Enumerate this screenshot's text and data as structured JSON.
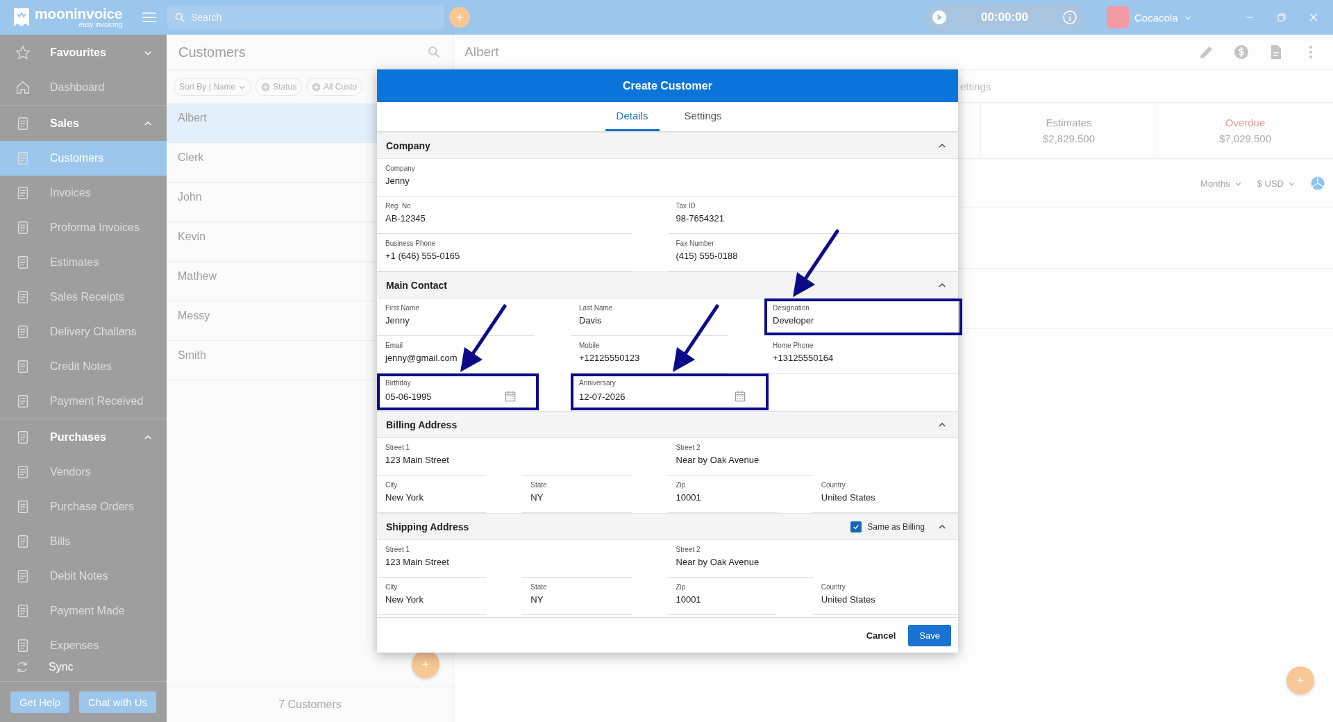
{
  "topbar": {
    "app_name": "mooninvoice",
    "tagline": "easy invoicing",
    "search": {
      "placeholder": "Search"
    },
    "timer": "00:00:00",
    "company": "Cocacola"
  },
  "sidebar": {
    "items": [
      {
        "kind": "group",
        "label": "Favourites",
        "expanded": false
      },
      {
        "kind": "item",
        "label": "Dashboard",
        "selected": false
      },
      {
        "kind": "group",
        "label": "Sales",
        "expanded": true,
        "children": [
          {
            "label": "Customers",
            "selected": true
          },
          {
            "label": "Invoices",
            "selected": false
          },
          {
            "label": "Proforma Invoices",
            "selected": false
          },
          {
            "label": "Estimates",
            "selected": false
          },
          {
            "label": "Sales Receipts",
            "selected": false
          },
          {
            "label": "Delivery Challans",
            "selected": false
          },
          {
            "label": "Credit Notes",
            "selected": false
          },
          {
            "label": "Payment Received",
            "selected": false
          }
        ]
      },
      {
        "kind": "group",
        "label": "Purchases",
        "expanded": true,
        "children": [
          {
            "label": "Vendors",
            "selected": false
          },
          {
            "label": "Purchase Orders",
            "selected": false
          },
          {
            "label": "Bills",
            "selected": false
          },
          {
            "label": "Debit Notes",
            "selected": false
          },
          {
            "label": "Payment Made",
            "selected": false
          },
          {
            "label": "Expenses",
            "selected": false
          }
        ]
      }
    ],
    "sync": "Sync",
    "buttons": [
      "Get Help",
      "Chat with Us"
    ]
  },
  "customers": {
    "title": "Customers",
    "filters": [
      "Sort By | Name",
      "Status",
      "All Custo"
    ],
    "rows": [
      {
        "name": "Albert",
        "selected": true
      },
      {
        "name": "Clerk",
        "selected": false
      },
      {
        "name": "John",
        "selected": false
      },
      {
        "name": "Kevin",
        "selected": false
      },
      {
        "name": "Mathew",
        "selected": false
      },
      {
        "name": "Messy",
        "selected": false
      },
      {
        "name": "Smith",
        "selected": false
      }
    ],
    "count": "7 Customers"
  },
  "detail": {
    "title": "Albert",
    "tab_fragment": "ettings",
    "stats": [
      {
        "label": "Estimates",
        "value": "$2,829.500",
        "kind": "normal"
      },
      {
        "label": "Overdue",
        "value": "$7,029.500",
        "kind": "alert"
      }
    ],
    "period": "Months",
    "currency": "$ USD"
  },
  "dialog": {
    "title": "Create Customer",
    "tabs": [
      {
        "label": "Details",
        "selected": true
      },
      {
        "label": "Settings",
        "selected": false
      }
    ],
    "sections": [
      {
        "title": "Company",
        "expanded": true,
        "rows": [
          [
            {
              "label": "Company",
              "value": "Jenny",
              "kind": "text",
              "highlighted": false
            }
          ],
          [
            {
              "label": "Reg. No",
              "value": "AB-12345",
              "kind": "text",
              "highlighted": false
            },
            {
              "label": "Tax ID",
              "value": "98-7654321",
              "kind": "text",
              "highlighted": false
            }
          ],
          [
            {
              "label": "Business Phone",
              "value": "+1 (646) 555-0165",
              "kind": "text",
              "highlighted": false
            },
            {
              "label": "Fax Number",
              "value": "(415) 555-0188",
              "kind": "text",
              "highlighted": false
            }
          ]
        ]
      },
      {
        "title": "Main Contact",
        "expanded": true,
        "rows": [
          [
            {
              "label": "First Name",
              "value": "Jenny",
              "kind": "text",
              "highlighted": false
            },
            {
              "label": "Last Name",
              "value": "Davis",
              "kind": "text",
              "highlighted": false
            },
            {
              "label": "Designation",
              "value": "Developer",
              "kind": "text",
              "highlighted": true
            }
          ],
          [
            {
              "label": "Email",
              "value": "jenny@gmail.com",
              "kind": "text",
              "highlighted": false
            },
            {
              "label": "Mobile",
              "value": "+12125550123",
              "kind": "text",
              "highlighted": false
            },
            {
              "label": "Home Phone",
              "value": "+13125550164",
              "kind": "text",
              "highlighted": false
            }
          ],
          [
            {
              "label": "Birthday",
              "value": "05-06-1995",
              "kind": "date",
              "highlighted": true
            },
            {
              "label": "Anniversary",
              "value": "12-07-2026",
              "kind": "date",
              "highlighted": true
            }
          ]
        ]
      },
      {
        "title": "Billing Address",
        "expanded": true,
        "rows": [
          [
            {
              "label": "Street 1",
              "value": "123 Main Street",
              "kind": "text",
              "highlighted": false
            },
            "",
            {
              "label": "Street 2",
              "value": "Near by Oak Avenue",
              "kind": "text",
              "highlighted": false
            }
          ],
          [
            {
              "label": "City",
              "value": "New York",
              "kind": "text",
              "highlighted": false
            },
            {
              "label": "State",
              "value": "NY",
              "kind": "text",
              "highlighted": false
            },
            {
              "label": "Zip",
              "value": "10001",
              "kind": "text",
              "highlighted": false
            },
            {
              "label": "Country",
              "value": "United States",
              "kind": "text",
              "highlighted": false
            }
          ]
        ]
      },
      {
        "title": "Shipping Address",
        "expanded": true,
        "same_as_billing": {
          "label": "Same as Billing",
          "checked": true
        },
        "rows": [
          [
            {
              "label": "Street 1",
              "value": "123 Main Street",
              "kind": "text",
              "highlighted": false
            },
            "",
            {
              "label": "Street 2",
              "value": "Near by Oak Avenue",
              "kind": "text",
              "highlighted": false
            }
          ],
          [
            {
              "label": "City",
              "value": "New York",
              "kind": "text",
              "highlighted": false
            },
            {
              "label": "State",
              "value": "NY",
              "kind": "text",
              "highlighted": false
            },
            {
              "label": "Zip",
              "value": "10001",
              "kind": "text",
              "highlighted": false
            },
            {
              "label": "Country",
              "value": "United States",
              "kind": "text",
              "highlighted": false
            }
          ]
        ]
      }
    ],
    "buttons": [
      {
        "label": "Cancel",
        "kind": "secondary"
      },
      {
        "label": "Save",
        "kind": "primary"
      }
    ]
  }
}
